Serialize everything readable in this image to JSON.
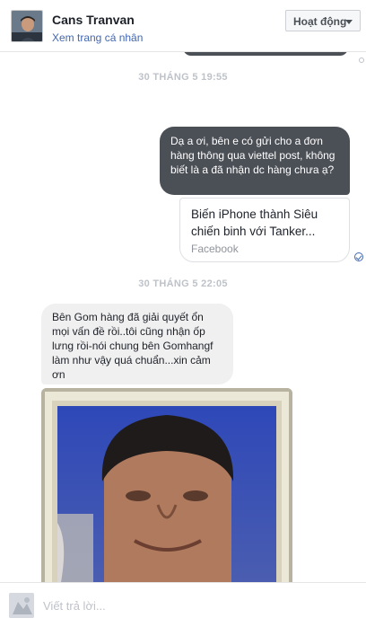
{
  "header": {
    "name": "Cans Tranvan",
    "profile_link": "Xem trang cá nhân",
    "status_button": "Hoạt động"
  },
  "thread": {
    "timestamp_1": "30 THÁNG 5 19:55",
    "outgoing_message": "Dạ a ơi, bên e có gửi cho a đơn hàng thông qua viettel post, không biết là a đã nhận dc hàng chưa ạ?",
    "link_card": {
      "title": "Biến iPhone thành Siêu chiến binh với Tanker...",
      "source": "Facebook"
    },
    "timestamp_2": "30 THÁNG 5 22:05",
    "incoming_message": "Bên Gom hàng đã giải quyết ổn mọi vấn đề rồi..tôi cũng nhận ốp lưng rồi-nói chung bên Gomhangf làm như vậy quá chuẩn...xin cảm ơn"
  },
  "composer": {
    "placeholder": "Viết trả lời..."
  },
  "colors": {
    "outgoing_bubble": "#4b4f56",
    "incoming_bubble": "#f1f0f0",
    "link": "#4267b2",
    "timestamp": "#bec2c9"
  },
  "icons": {
    "dropdown": "chevron-down-icon",
    "seen": "check-circle-icon"
  }
}
